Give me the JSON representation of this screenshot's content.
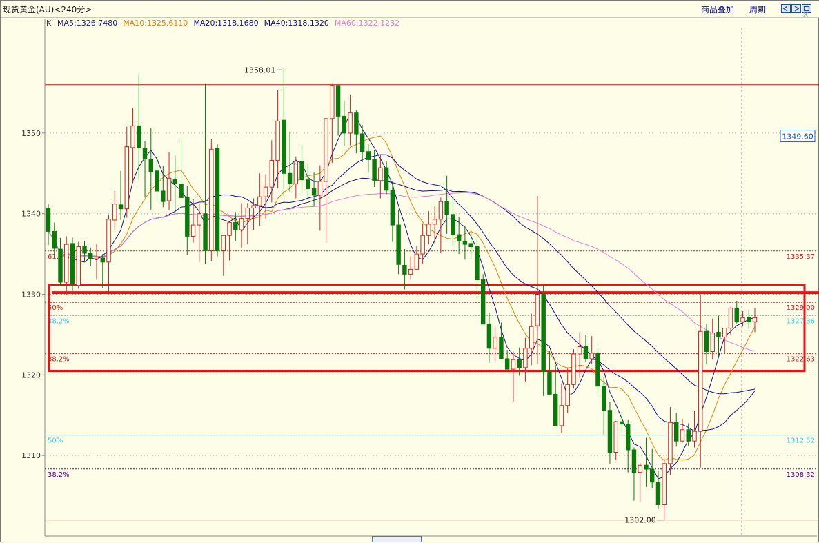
{
  "window": {
    "title": "现货黄金(AU)<240分>"
  },
  "toolbar": {
    "overlay_label": "商品叠加",
    "period_label": "周期"
  },
  "legend": {
    "k_label": "K",
    "items": [
      {
        "text": "MA5:1326.7480",
        "color": "#1a1a80"
      },
      {
        "text": "MA10:1325.6110",
        "color": "#e8820a"
      },
      {
        "text": "MA20:1318.1680",
        "color": "#1010a0"
      },
      {
        "text": "MA40:1318.1320",
        "color": "#101080"
      },
      {
        "text": "MA60:1322.1232",
        "color": "#e080e0"
      }
    ]
  },
  "chart_data": {
    "type": "candlestick",
    "symbol": "现货黄金(AU)",
    "period": "240分",
    "ylim": [
      1300,
      1363
    ],
    "y_ticks": [
      1310,
      1320,
      1330,
      1340,
      1350
    ],
    "current_price_label": "1349.60",
    "current_price": 1349.6,
    "high_annotation": {
      "label": "1358.01",
      "value": 1358.01
    },
    "low_annotation": {
      "label": "1302.00",
      "value": 1302.0
    },
    "fib_levels": [
      {
        "pct": "61.8%",
        "value": 1335.37,
        "value_label": "1335.37",
        "color": "#cc2222"
      },
      {
        "pct": "50%",
        "value": 1329.0,
        "value_label": "1329.00",
        "color": "#cc2222"
      },
      {
        "pct": "38.2%",
        "value": 1327.36,
        "value_label": "1327.36",
        "color": "#33ccee"
      },
      {
        "pct": "38.2%",
        "value": 1322.63,
        "value_label": "1322.63",
        "color": "#cc2222"
      },
      {
        "pct": "50%",
        "value": 1312.52,
        "value_label": "1312.52",
        "color": "#33ccee"
      },
      {
        "pct": "38.2%",
        "value": 1308.32,
        "value_label": "1308.32",
        "color": "#660099"
      }
    ],
    "candles": [
      [
        1340.7,
        1341.2,
        1336.1,
        1337.8
      ],
      [
        1337.8,
        1338.9,
        1334.5,
        1335.7
      ],
      [
        1335.6,
        1337.0,
        1331.0,
        1331.5
      ],
      [
        1331.5,
        1337.2,
        1329.9,
        1336.2
      ],
      [
        1336.3,
        1337.0,
        1330.3,
        1331.3
      ],
      [
        1331.1,
        1336.5,
        1330.7,
        1335.9
      ],
      [
        1335.9,
        1336.6,
        1334.0,
        1335.1
      ],
      [
        1335.1,
        1335.8,
        1333.5,
        1334.4
      ],
      [
        1334.4,
        1336.2,
        1331.8,
        1334.6
      ],
      [
        1334.5,
        1335.0,
        1330.8,
        1334.0
      ],
      [
        1334.0,
        1339.8,
        1330.3,
        1339.3
      ],
      [
        1339.2,
        1342.8,
        1337.9,
        1341.2
      ],
      [
        1341.1,
        1345.3,
        1339.2,
        1340.6
      ],
      [
        1340.6,
        1350.8,
        1339.5,
        1348.3
      ],
      [
        1348.2,
        1353.1,
        1343.8,
        1350.9
      ],
      [
        1350.9,
        1357.3,
        1344.2,
        1348.2
      ],
      [
        1348.1,
        1349.0,
        1342.0,
        1346.8
      ],
      [
        1346.7,
        1350.6,
        1340.5,
        1345.2
      ],
      [
        1345.3,
        1347.1,
        1341.5,
        1342.8
      ],
      [
        1342.8,
        1345.9,
        1340.8,
        1341.5
      ],
      [
        1341.6,
        1347.6,
        1340.4,
        1344.4
      ],
      [
        1344.3,
        1347.2,
        1340.2,
        1343.7
      ],
      [
        1343.7,
        1349.3,
        1342.8,
        1342.0
      ],
      [
        1342.0,
        1343.5,
        1334.9,
        1337.2
      ],
      [
        1337.2,
        1341.8,
        1336.4,
        1338.6
      ],
      [
        1338.6,
        1341.5,
        1334.0,
        1340.0
      ],
      [
        1340.0,
        1356.1,
        1333.8,
        1335.4
      ],
      [
        1335.4,
        1349.3,
        1334.1,
        1348.0
      ],
      [
        1348.1,
        1348.6,
        1334.7,
        1335.4
      ],
      [
        1335.4,
        1336.1,
        1332.3,
        1337.3
      ],
      [
        1337.3,
        1338.6,
        1334.2,
        1338.9
      ],
      [
        1338.9,
        1340.2,
        1336.6,
        1338.0
      ],
      [
        1338.0,
        1341.3,
        1335.8,
        1339.4
      ],
      [
        1339.4,
        1341.3,
        1336.2,
        1340.7
      ],
      [
        1340.7,
        1341.9,
        1338.0,
        1341.0
      ],
      [
        1341.0,
        1345.0,
        1338.5,
        1342.1
      ],
      [
        1342.1,
        1344.9,
        1339.4,
        1343.3
      ],
      [
        1343.3,
        1349.1,
        1341.4,
        1346.6
      ],
      [
        1346.6,
        1355.3,
        1343.2,
        1351.5
      ],
      [
        1351.6,
        1358.01,
        1342.2,
        1345.0
      ],
      [
        1345.0,
        1350.2,
        1342.6,
        1343.7
      ],
      [
        1343.7,
        1347.1,
        1341.9,
        1346.5
      ],
      [
        1346.5,
        1348.6,
        1342.5,
        1344.2
      ],
      [
        1344.2,
        1346.2,
        1341.7,
        1343.1
      ],
      [
        1343.1,
        1345.1,
        1340.9,
        1342.3
      ],
      [
        1342.3,
        1346.0,
        1337.9,
        1344.0
      ],
      [
        1344.0,
        1349.0,
        1336.4,
        1351.8
      ],
      [
        1351.8,
        1356.1,
        1346.3,
        1355.9
      ],
      [
        1355.9,
        1356.0,
        1349.7,
        1352.1
      ],
      [
        1352.1,
        1354.0,
        1348.4,
        1350.0
      ],
      [
        1350.0,
        1354.8,
        1348.5,
        1352.5
      ],
      [
        1352.5,
        1352.8,
        1347.5,
        1349.9
      ],
      [
        1349.9,
        1351.0,
        1346.4,
        1347.7
      ],
      [
        1347.7,
        1348.6,
        1345.2,
        1346.7
      ],
      [
        1346.7,
        1347.9,
        1343.3,
        1344.1
      ],
      [
        1344.1,
        1347.3,
        1341.9,
        1345.7
      ],
      [
        1345.7,
        1346.5,
        1342.4,
        1342.9
      ],
      [
        1342.9,
        1344.0,
        1336.5,
        1338.6
      ],
      [
        1338.6,
        1340.5,
        1332.5,
        1333.7
      ],
      [
        1333.6,
        1335.6,
        1330.6,
        1332.5
      ],
      [
        1332.5,
        1334.7,
        1331.8,
        1333.1
      ],
      [
        1333.1,
        1336.0,
        1334.5,
        1335.0
      ],
      [
        1335.0,
        1338.8,
        1333.8,
        1337.3
      ],
      [
        1337.3,
        1340.3,
        1336.2,
        1338.7
      ],
      [
        1338.7,
        1340.9,
        1336.3,
        1339.3
      ],
      [
        1339.3,
        1342.0,
        1335.1,
        1341.5
      ],
      [
        1341.5,
        1344.7,
        1337.5,
        1339.9
      ],
      [
        1339.9,
        1342.0,
        1336.0,
        1337.4
      ],
      [
        1337.4,
        1339.6,
        1335.0,
        1336.6
      ],
      [
        1336.6,
        1338.5,
        1334.3,
        1336.2
      ],
      [
        1336.3,
        1337.9,
        1334.6,
        1335.9
      ],
      [
        1335.9,
        1337.0,
        1329.2,
        1331.8
      ],
      [
        1331.8,
        1332.5,
        1326.3,
        1326.3
      ],
      [
        1326.3,
        1327.7,
        1321.5,
        1323.3
      ],
      [
        1323.3,
        1326.0,
        1321.7,
        1324.7
      ],
      [
        1324.7,
        1326.5,
        1322.3,
        1322.0
      ],
      [
        1322.0,
        1323.1,
        1321.7,
        1320.7
      ],
      [
        1320.7,
        1322.9,
        1316.7,
        1321.9
      ],
      [
        1321.9,
        1323.4,
        1319.9,
        1320.9
      ],
      [
        1320.9,
        1324.6,
        1319.2,
        1323.3
      ],
      [
        1323.3,
        1327.6,
        1321.2,
        1326.0
      ],
      [
        1326.1,
        1342.2,
        1321.3,
        1330.0
      ],
      [
        1330.0,
        1331.1,
        1317.4,
        1320.4
      ],
      [
        1320.4,
        1323.0,
        1318.6,
        1317.6
      ],
      [
        1317.6,
        1321.2,
        1314.8,
        1313.7
      ],
      [
        1313.7,
        1318.9,
        1312.8,
        1316.2
      ],
      [
        1316.2,
        1320.9,
        1315.3,
        1318.8
      ],
      [
        1318.8,
        1323.2,
        1318.3,
        1322.6
      ],
      [
        1322.6,
        1325.3,
        1319.6,
        1323.5
      ],
      [
        1323.5,
        1325.0,
        1321.6,
        1322.0
      ],
      [
        1322.0,
        1324.8,
        1321.4,
        1322.7
      ],
      [
        1322.7,
        1323.4,
        1317.6,
        1318.6
      ],
      [
        1318.6,
        1319.7,
        1312.6,
        1315.6
      ],
      [
        1315.6,
        1316.7,
        1309.0,
        1310.4
      ],
      [
        1310.4,
        1314.3,
        1309.5,
        1314.2
      ],
      [
        1314.2,
        1315.4,
        1312.5,
        1313.9
      ],
      [
        1313.9,
        1314.4,
        1307.9,
        1310.7
      ],
      [
        1310.7,
        1311.0,
        1304.4,
        1307.9
      ],
      [
        1307.9,
        1309.1,
        1304.2,
        1308.8
      ],
      [
        1308.8,
        1312.2,
        1306.1,
        1308.3
      ],
      [
        1308.3,
        1310.8,
        1305.9,
        1306.7
      ],
      [
        1306.7,
        1308.1,
        1303.4,
        1303.9
      ],
      [
        1303.9,
        1309.6,
        1302.0,
        1309.0
      ],
      [
        1309.0,
        1316.0,
        1307.6,
        1314.1
      ],
      [
        1314.1,
        1315.3,
        1311.1,
        1311.8
      ],
      [
        1311.8,
        1314.5,
        1311.6,
        1313.2
      ],
      [
        1313.2,
        1314.0,
        1311.2,
        1311.8
      ],
      [
        1311.8,
        1315.5,
        1311.0,
        1313.0
      ],
      [
        1313.0,
        1330.0,
        1308.5,
        1325.4
      ],
      [
        1325.4,
        1326.3,
        1321.3,
        1322.9
      ],
      [
        1322.9,
        1327.0,
        1321.9,
        1325.2
      ],
      [
        1325.3,
        1327.3,
        1322.3,
        1324.7
      ],
      [
        1324.7,
        1325.7,
        1322.6,
        1325.8
      ],
      [
        1325.8,
        1328.4,
        1325.0,
        1328.3
      ],
      [
        1328.3,
        1329.2,
        1326.4,
        1326.6
      ],
      [
        1326.6,
        1327.9,
        1326.0,
        1327.1
      ],
      [
        1327.1,
        1328.0,
        1325.7,
        1326.6
      ],
      [
        1326.6,
        1328.3,
        1325.3,
        1327.1
      ]
    ],
    "ma_series": [
      {
        "name": "MA5",
        "color": "#1a1a80"
      },
      {
        "name": "MA10",
        "color": "#e8820a"
      },
      {
        "name": "MA20",
        "color": "#1010a0"
      },
      {
        "name": "MA40",
        "color": "#101080"
      },
      {
        "name": "MA60",
        "color": "#e080e0"
      }
    ],
    "horizontal_lines": [
      {
        "value": 1356.0,
        "color": "#cc1111"
      },
      {
        "value": 1302.0,
        "color": "#cc1111"
      },
      {
        "value": 1330.2,
        "color": "#ee1111"
      }
    ],
    "highlight_zone": {
      "top": 1331.2,
      "bottom": 1320.5,
      "color": "#ee1111"
    }
  }
}
